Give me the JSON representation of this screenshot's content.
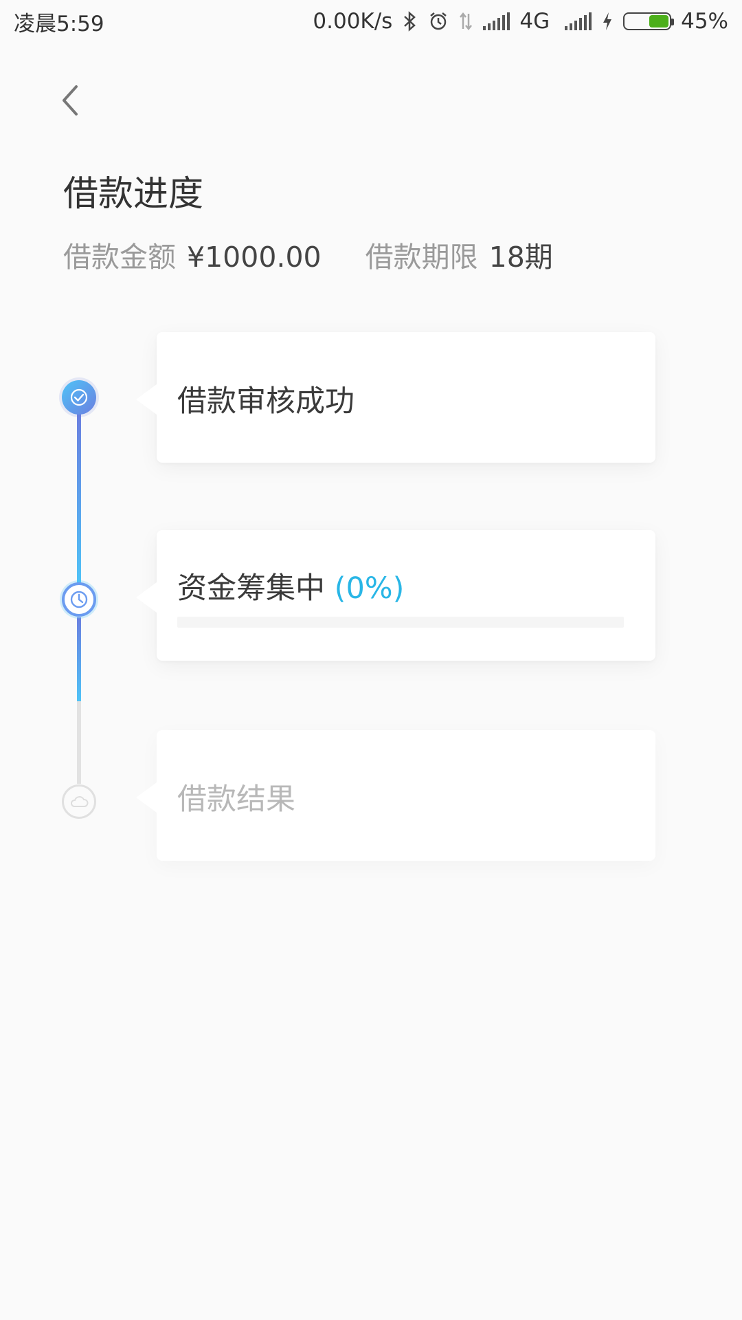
{
  "status_bar": {
    "time": "凌晨5:59",
    "network_speed": "0.00K/s",
    "icons": [
      "bluetooth-icon",
      "alarm-icon",
      "data-arrows-icon",
      "signal-icon",
      "signal-icon",
      "charging-icon",
      "battery-icon"
    ],
    "network_type": "4G",
    "battery_percent_text": "45%",
    "battery_level": 0.45
  },
  "header": {
    "back_icon": "chevron-left-icon",
    "title": "借款进度"
  },
  "summary": {
    "amount_label": "借款金额",
    "amount_value": "¥1000.00",
    "term_label": "借款期限",
    "term_value": "18期"
  },
  "steps": [
    {
      "title": "借款审核成功",
      "status": "done",
      "icon": "check-icon"
    },
    {
      "title": "资金筹集中",
      "progress_text": "(0%)",
      "progress": 0,
      "status": "active",
      "icon": "clock-icon"
    },
    {
      "title": "借款结果",
      "status": "pending",
      "icon": "cloud-icon"
    }
  ],
  "colors": {
    "accent_blue": "#29b6e6",
    "accent_indigo": "#6b7fe0",
    "battery_green": "#4caf1a",
    "background": "#fafafa"
  }
}
